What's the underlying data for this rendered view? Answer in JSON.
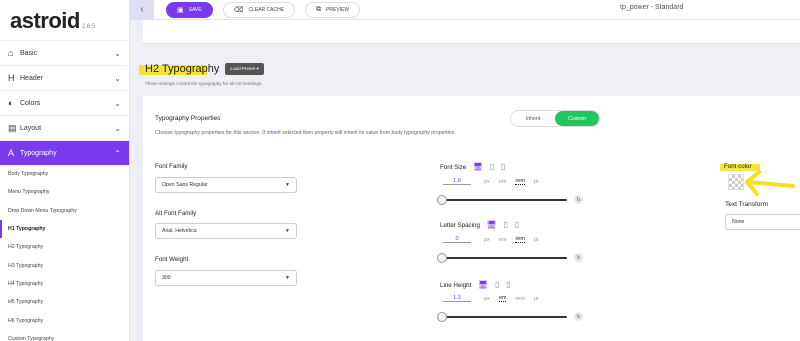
{
  "brand": {
    "name": "astroid",
    "version": "2.6.5"
  },
  "sidebar": {
    "sections": [
      {
        "icon": "⌂",
        "label": "Basic"
      },
      {
        "icon": "H",
        "label": "Header"
      },
      {
        "icon": "◐",
        "label": "Colors"
      },
      {
        "icon": "▤",
        "label": "Layout"
      },
      {
        "icon": "A",
        "label": "Typography"
      }
    ],
    "sub_items": [
      "Body Typography",
      "Menu Typography",
      "Drop Down Menu Typography",
      "H1 Typography",
      "H2 Typography",
      "H3 Typography",
      "H4 Typography",
      "H5 Typography",
      "H6 Typography",
      "Custom Typography"
    ]
  },
  "toolbar": {
    "back_icon": "‹",
    "save": "SAVE",
    "clear_cache": "CLEAR CACHE",
    "preview": "PREVIEW",
    "template_title": "tp_power - Standard"
  },
  "section": {
    "title": "H2 Typography",
    "load_preset": "Load Preset ▾",
    "description": "These settings control the typography for all H2 headings."
  },
  "typography_properties": {
    "title": "Typography Properties",
    "desc_pre": "Choose typography properties for this section. If ",
    "desc_kw": "inherit",
    "desc_post": " selected then property will inherit its value from body typography properties.",
    "toggle": {
      "inherit": "Inherit",
      "custom": "Custom",
      "selected": "Custom"
    }
  },
  "fields": {
    "font_family": {
      "label": "Font Family",
      "value": "Open Sans Regular"
    },
    "alt_font_family": {
      "label": "Alt Font Family",
      "value": "Arial, Helvetica"
    },
    "font_weight": {
      "label": "Font Weight",
      "value": "300"
    },
    "font_size": {
      "label": "Font Size",
      "value": "1.8",
      "units": [
        "px",
        "em",
        "rem",
        "pt"
      ],
      "selected_unit": "rem"
    },
    "letter_spacing": {
      "label": "Letter Spacing",
      "value": "0",
      "units": [
        "px",
        "em",
        "rem",
        "pt"
      ],
      "selected_unit": "rem"
    },
    "line_height": {
      "label": "Line Height",
      "value": "1.3",
      "units": [
        "px",
        "em",
        "rem",
        "pt"
      ],
      "selected_unit": "em"
    },
    "font_color": {
      "label": "Font color"
    },
    "text_transform": {
      "label": "Text Transform",
      "value": "None"
    }
  },
  "colors": {
    "accent": "#7c3aed",
    "toggle_on": "#22c55e",
    "highlight": "#f5e11d"
  }
}
